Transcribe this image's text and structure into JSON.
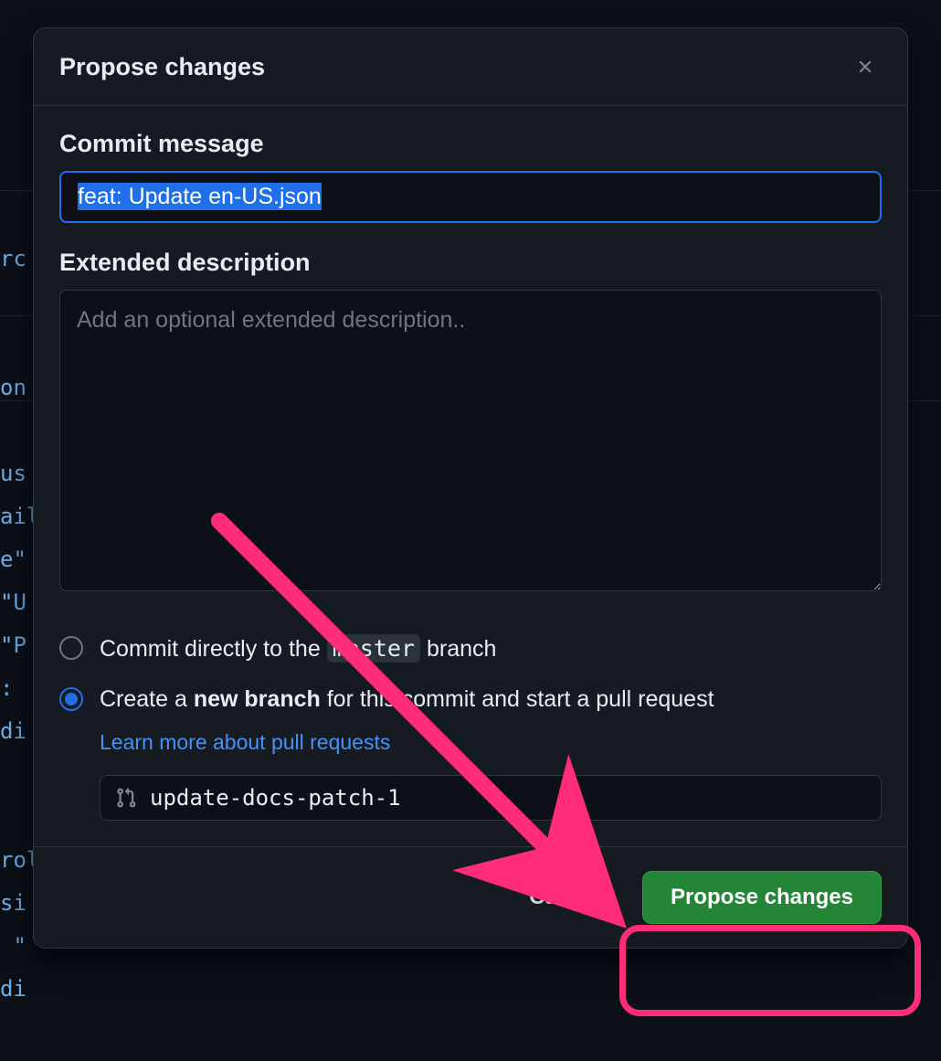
{
  "dialog": {
    "title": "Propose changes",
    "commit_message": {
      "label": "Commit message",
      "value": "feat: Update en-US.json"
    },
    "extended_description": {
      "label": "Extended description",
      "placeholder": "Add an optional extended description.."
    },
    "commit_option_direct": {
      "prefix": "Commit directly to the",
      "branch": "master",
      "suffix": "branch",
      "selected": false
    },
    "commit_option_new_branch": {
      "prefix": "Create a",
      "bold": "new branch",
      "suffix": "for this commit and start a pull request",
      "selected": true
    },
    "learn_more_link": "Learn more about pull requests",
    "branch_name": {
      "value": "update-docs-patch-1"
    },
    "footer": {
      "cancel": "Cancel",
      "submit": "Propose changes"
    }
  },
  "background_text": "rc\n\n\non\n\nus\nail\ne\"\n\"U\n\"P\n:\ndi\n\n\nrol\nsi\n \"\ndi",
  "annotation": {
    "type": "arrow-and-ring",
    "target": "propose-changes-button",
    "color": "#ff2d78"
  }
}
